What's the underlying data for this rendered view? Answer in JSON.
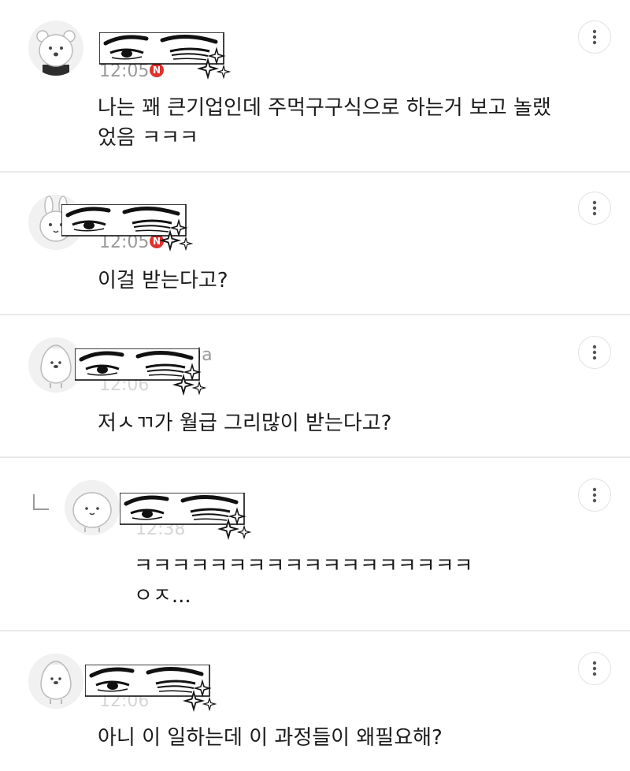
{
  "comments": [
    {
      "time": "12:05",
      "name": "",
      "text": "나는 꽤 큰기업인데 주먹구구식으로 하는거 보고 놀랬\n었음 ㅋㅋㅋ",
      "badge": "N",
      "avatar_icon": "bear-avatar-icon"
    },
    {
      "time": "12:05",
      "name": "",
      "text": "이걸 받는다고?",
      "badge": "N",
      "avatar_icon": "rabbit-avatar-icon"
    },
    {
      "time": "12:06",
      "name": "ia",
      "text": "저ㅅㄲ가 월급 그리많이 받는다고?",
      "badge": "",
      "avatar_icon": "penguin-avatar-icon"
    },
    {
      "time": "12:38",
      "name": "",
      "text": "ㅋㅋㅋㅋㅋㅋㅋㅋㅋㅋㅋㅋㅋㅋㅋㅋㅋㅋ\nㅇㅈ...",
      "badge": "",
      "avatar_icon": "mochi-avatar-icon",
      "is_reply": true
    },
    {
      "time": "12:06",
      "name": "",
      "text": "아니 이 일하는데 이 과정들이 왜필요해?",
      "badge": "",
      "avatar_icon": "penguin-avatar-icon"
    }
  ],
  "ui": {
    "more_icon": "more-vertical-icon",
    "sticker_icon": "smug-eyes-sticker-icon",
    "reply_icon": "reply-arrow-icon",
    "badge_color": "#e0312e",
    "divider_color": "#e9e9e9"
  }
}
